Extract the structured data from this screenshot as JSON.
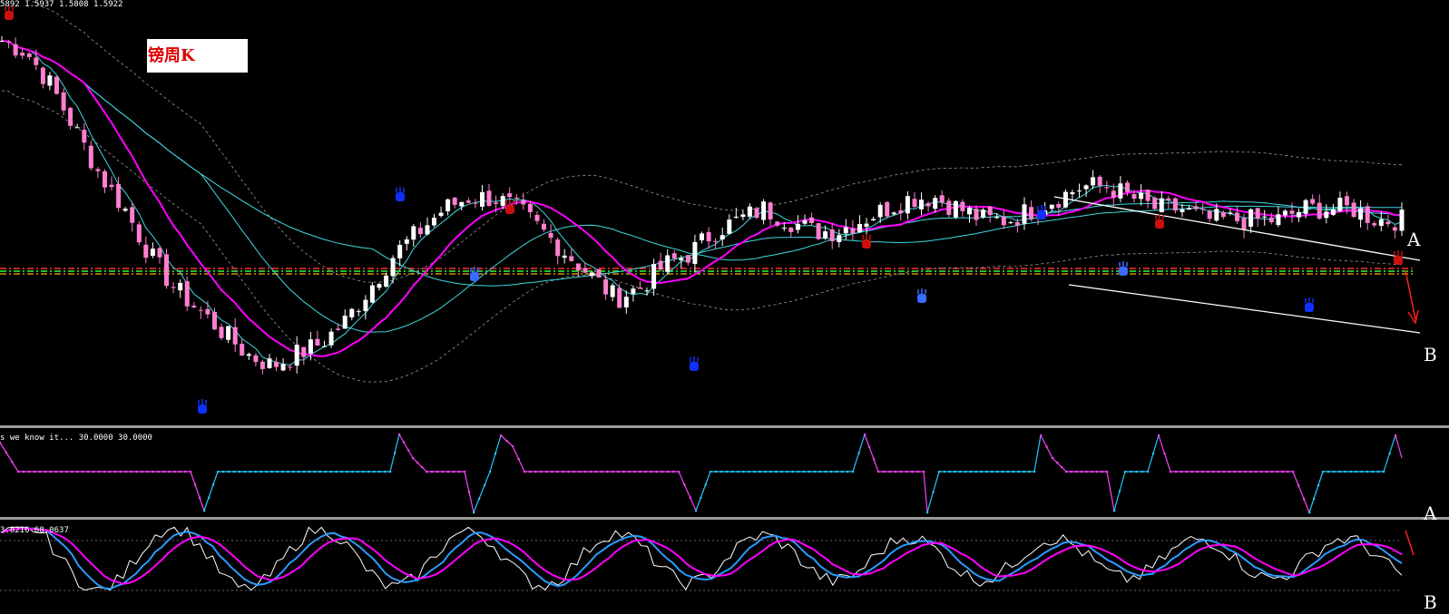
{
  "header": {
    "price_text": "5892 1.5937 1.5808 1.5922",
    "osc1_text": "s we know it...  30.0000 30.0000",
    "osc2_text": "3.8216 68.0637"
  },
  "title": "镑周K",
  "annotations": {
    "a_upper": "A",
    "b_upper": "B",
    "a_lower": "A",
    "b_lower": "B"
  },
  "chart_data": {
    "type": "candlestick",
    "title": "镑周K",
    "price_seed": [
      1.64,
      1.63,
      1.6,
      1.56,
      1.52,
      1.49,
      1.45,
      1.42,
      1.4,
      1.38,
      1.36,
      1.35,
      1.36,
      1.37,
      1.39,
      1.42,
      1.45,
      1.47,
      1.49,
      1.5,
      1.5,
      1.49,
      1.47,
      1.45,
      1.43,
      1.41,
      1.42,
      1.44,
      1.45,
      1.47,
      1.48,
      1.49,
      1.48,
      1.47,
      1.47,
      1.48,
      1.49,
      1.5,
      1.5,
      1.49,
      1.48,
      1.48,
      1.49,
      1.5,
      1.51,
      1.51,
      1.5,
      1.49,
      1.49,
      1.48,
      1.48,
      1.48,
      1.48,
      1.49,
      1.49,
      1.49,
      1.48,
      1.48
    ],
    "horizontal_levels": [
      "dash-dot-red",
      "dash-dot-green",
      "dash-dot-orange"
    ],
    "colors": {
      "bull_candle": "#ffffff",
      "bear_candle": "#ff7fcf",
      "ma_fast": "#ff00ff",
      "ma_cyan": "#40d8e0",
      "band": "#9a9a9a",
      "trend": "#ffffff",
      "arrow": "#ff2020",
      "osc_pink": "#ff40ff",
      "osc_cyan": "#20c8ff",
      "stoch_white": "#ffffff",
      "stoch_blue": "#2a9bff",
      "stoch_magenta": "#ff00ff"
    }
  }
}
